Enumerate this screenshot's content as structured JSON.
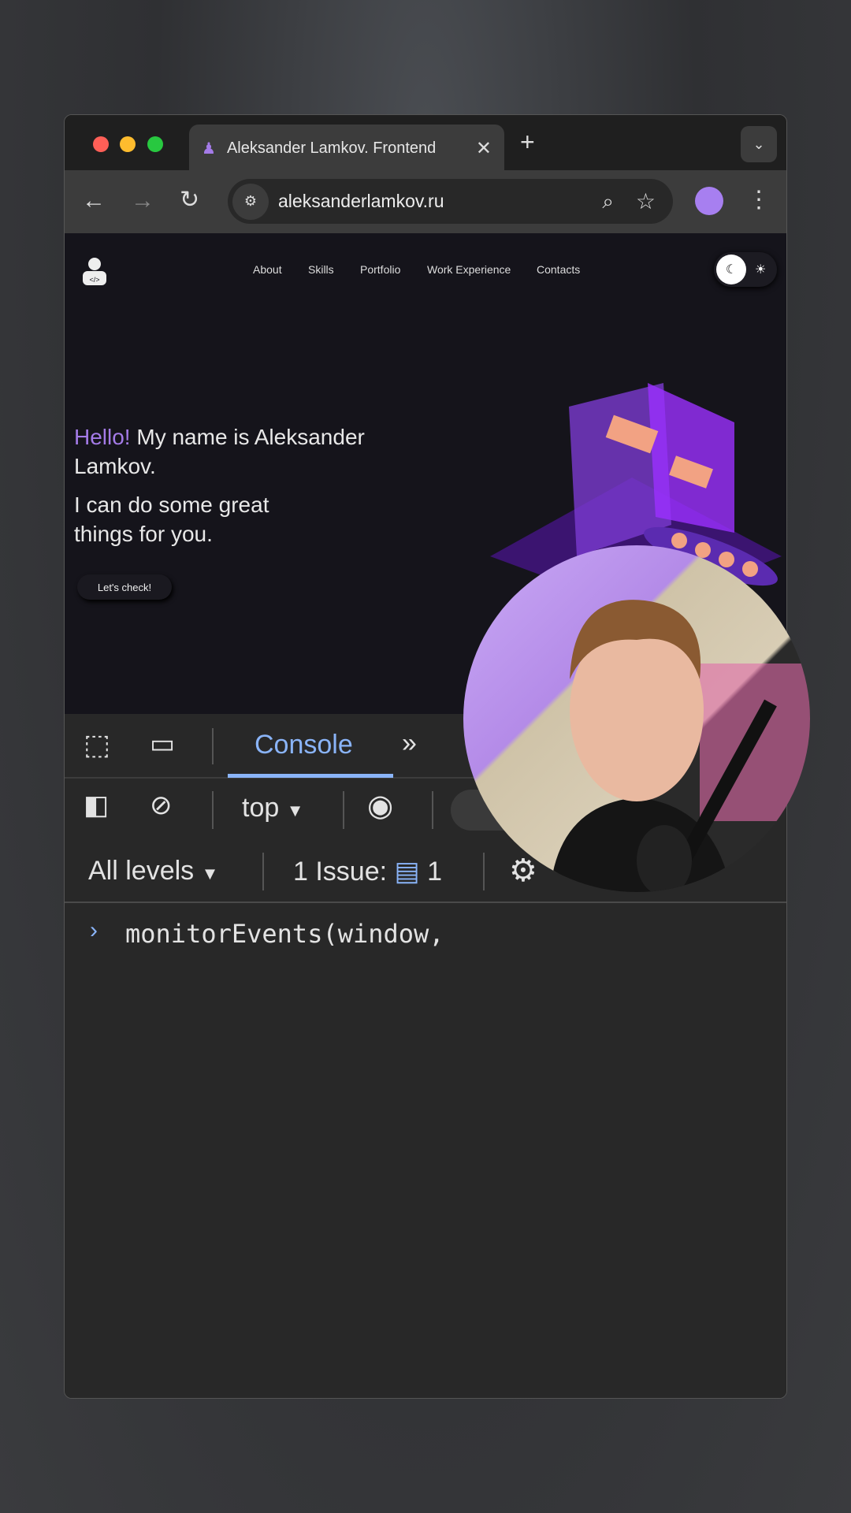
{
  "browser": {
    "tab_title": "Aleksander Lamkov. Frontend",
    "url": "aleksanderlamkov.ru",
    "icons": [
      "back-icon",
      "forward-icon",
      "reload-icon",
      "site-settings-icon",
      "zoom-icon",
      "star-icon",
      "profile-avatar",
      "menu-icon",
      "new-tab-icon",
      "tab-list-icon",
      "close-icon"
    ]
  },
  "site": {
    "nav": [
      "About",
      "Skills",
      "Portfolio",
      "Work Experience",
      "Contacts"
    ],
    "hello": "Hello!",
    "intro": "My name is Aleksander Lamkov.",
    "tagline": "I can do some great things for you.",
    "cta": "Let's check!",
    "accent": "#a47be8"
  },
  "devtools": {
    "active_tab": "Console",
    "context": "top",
    "levels": "All levels",
    "issues_label": "1 Issue:",
    "issues_count": "1",
    "accent": "#8ab4f8",
    "input": "monitorEvents(window,"
  }
}
